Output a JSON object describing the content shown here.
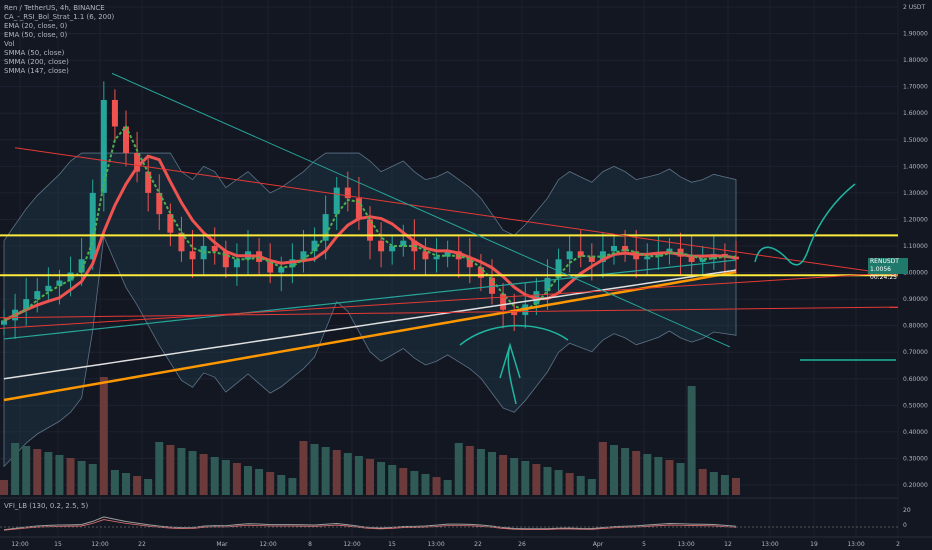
{
  "legend": {
    "title": "Ren / TetherUS, 4h, BINANCE",
    "indicators": [
      "CA_-_RSI_Bol_Strat_1.1 (6, 200)",
      "EMA (20, close, 0)",
      "EMA (50, close, 0)",
      "Vol",
      "SMMA (50, close)",
      "SMMA (200, close)",
      "SMMA (147, close)"
    ]
  },
  "sub_pane_label": "VFI_LB (130, 0.2, 2.5, 5)",
  "price_badge": {
    "symbol": "RENUSDT",
    "price": "1.0056",
    "time": "00:24:25"
  },
  "colors": {
    "background": "#131722",
    "up": "#26a69a",
    "down": "#ef5350",
    "yellow": "#ffeb3b",
    "orange": "#ff9800",
    "teal_draw": "#1fb5a0",
    "red_line": "#e53935"
  },
  "chart_data": {
    "type": "candlestick",
    "y_axis": {
      "unit": "USDT",
      "ticks": [
        "2 USDT",
        "1.90000",
        "1.80000",
        "1.70000",
        "1.60000",
        "1.50000",
        "1.40000",
        "1.30000",
        "1.20000",
        "1.10000",
        "1.00000",
        "0.90000",
        "0.80000",
        "0.70000",
        "0.60000",
        "0.50000",
        "0.40000",
        "0.30000",
        "0.20000"
      ],
      "tick_values": [
        2.0,
        1.9,
        1.8,
        1.7,
        1.6,
        1.5,
        1.4,
        1.3,
        1.2,
        1.1,
        1.0,
        0.9,
        0.8,
        0.7,
        0.6,
        0.5,
        0.4,
        0.3,
        0.2
      ]
    },
    "x_axis": {
      "labels": [
        "12:00",
        "15",
        "12:00",
        "22",
        "Mar",
        "12:00",
        "8",
        "12:00",
        "15",
        "13:00",
        "22",
        "26",
        "Apr",
        "5",
        "13:00",
        "12",
        "13:00",
        "19",
        "13:00",
        "2"
      ]
    },
    "vfi_ticks": [
      "20",
      "0"
    ],
    "horizontal_levels": [
      1.14,
      0.99
    ],
    "price_series": [
      0.82,
      0.86,
      0.9,
      0.93,
      0.95,
      0.97,
      1.0,
      1.05,
      1.3,
      1.65,
      1.55,
      1.45,
      1.38,
      1.3,
      1.22,
      1.15,
      1.08,
      1.05,
      1.1,
      1.08,
      1.02,
      1.05,
      1.08,
      1.04,
      1.0,
      1.02,
      1.05,
      1.08,
      1.12,
      1.22,
      1.32,
      1.28,
      1.2,
      1.12,
      1.08,
      1.1,
      1.12,
      1.08,
      1.05,
      1.06,
      1.08,
      1.05,
      1.02,
      0.98,
      0.92,
      0.86,
      0.84,
      0.88,
      0.93,
      0.98,
      1.05,
      1.08,
      1.06,
      1.04,
      1.08,
      1.1,
      1.08,
      1.05,
      1.06,
      1.07,
      1.09,
      1.06,
      1.04,
      1.05,
      1.07,
      1.06,
      1.05
    ]
  }
}
